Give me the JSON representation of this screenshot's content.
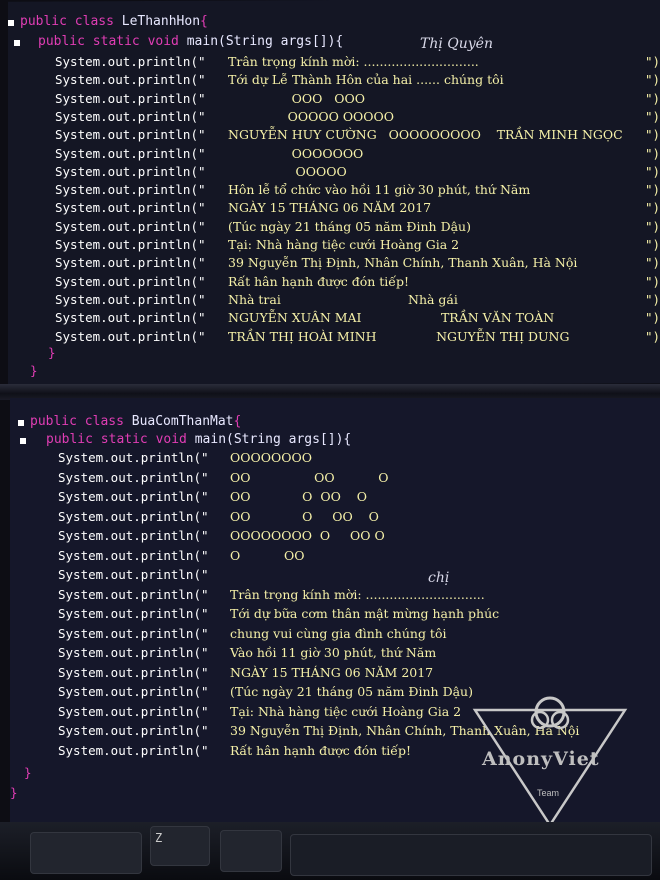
{
  "class1": {
    "decl_kw": "public class",
    "name": "LeThanhHon",
    "brace": "{",
    "main_kw": "public static void",
    "main_sig": "main(String args[]){",
    "lines": [
      "Trân trọng kính mời: .............................",
      "Tới dự Lễ Thành Hôn của hai ...... chúng tôi",
      "                OOO   OOO",
      "               OOOOO OOOOO",
      "NGUYỄN HUY CƯỜNG   OOOOOOOOO    TRẦN MINH NGỌC",
      "                OOOOOOO",
      "                 OOOOO",
      "Hôn lễ tổ chức vào hồi 11 giờ 30 phút, thứ Năm",
      "NGÀY 15 THÁNG 06 NĂM 2017",
      "(Túc ngày 21 tháng 05 năm Đinh Dậu)",
      "Tại: Nhà hàng tiệc cưới Hoàng Gia 2",
      "39 Nguyễn Thị Định, Nhân Chính, Thanh Xuân, Hà Nội",
      "Rất hân hạnh được đón tiếp!",
      "Nhà trai                                Nhà gái",
      "NGUYỄN XUÂN MAI                    TRẦN VĂN TOÀN",
      "TRẦN THỊ HOÀI MINH               NGUYỄN THỊ DUNG"
    ],
    "handwriting": "Thị  Quyên",
    "close1": "}",
    "close2": "}"
  },
  "class2": {
    "decl_kw": "public class",
    "name": "BuaComThanMat",
    "brace": "{",
    "main_kw": "public static void",
    "main_sig": "main(String args[]){",
    "lines": [
      "OOOOOOOO",
      "OO                OO           O",
      "OO             O  OO    O",
      "OO             O     OO    O",
      "OOOOOOOO  O     OO O",
      "O           OO",
      "",
      "Trân trọng kính mời: ..............................",
      "Tới dự bữa cơm thân mật mừng hạnh phúc",
      "chung vui cùng gia đình chúng tôi",
      "Vào hồi 11 giờ 30 phút, thứ Năm",
      "NGÀY 15 THÁNG 06 NĂM 2017",
      "(Túc ngày 21 tháng 05 năm Đinh Dậu)",
      "Tại: Nhà hàng tiệc cưới Hoàng Gia 2",
      "39 Nguyễn Thị Định, Nhân Chính, Thanh Xuân, Hà Nội",
      "Rất hân hạnh được đón tiếp!"
    ],
    "handwriting": "chị",
    "close1": "}",
    "close2": "}"
  },
  "println": "System.out.println(\"",
  "watermark": {
    "brand": "AnonyViet",
    "sub": "Team"
  },
  "keyboard_key": "Z"
}
